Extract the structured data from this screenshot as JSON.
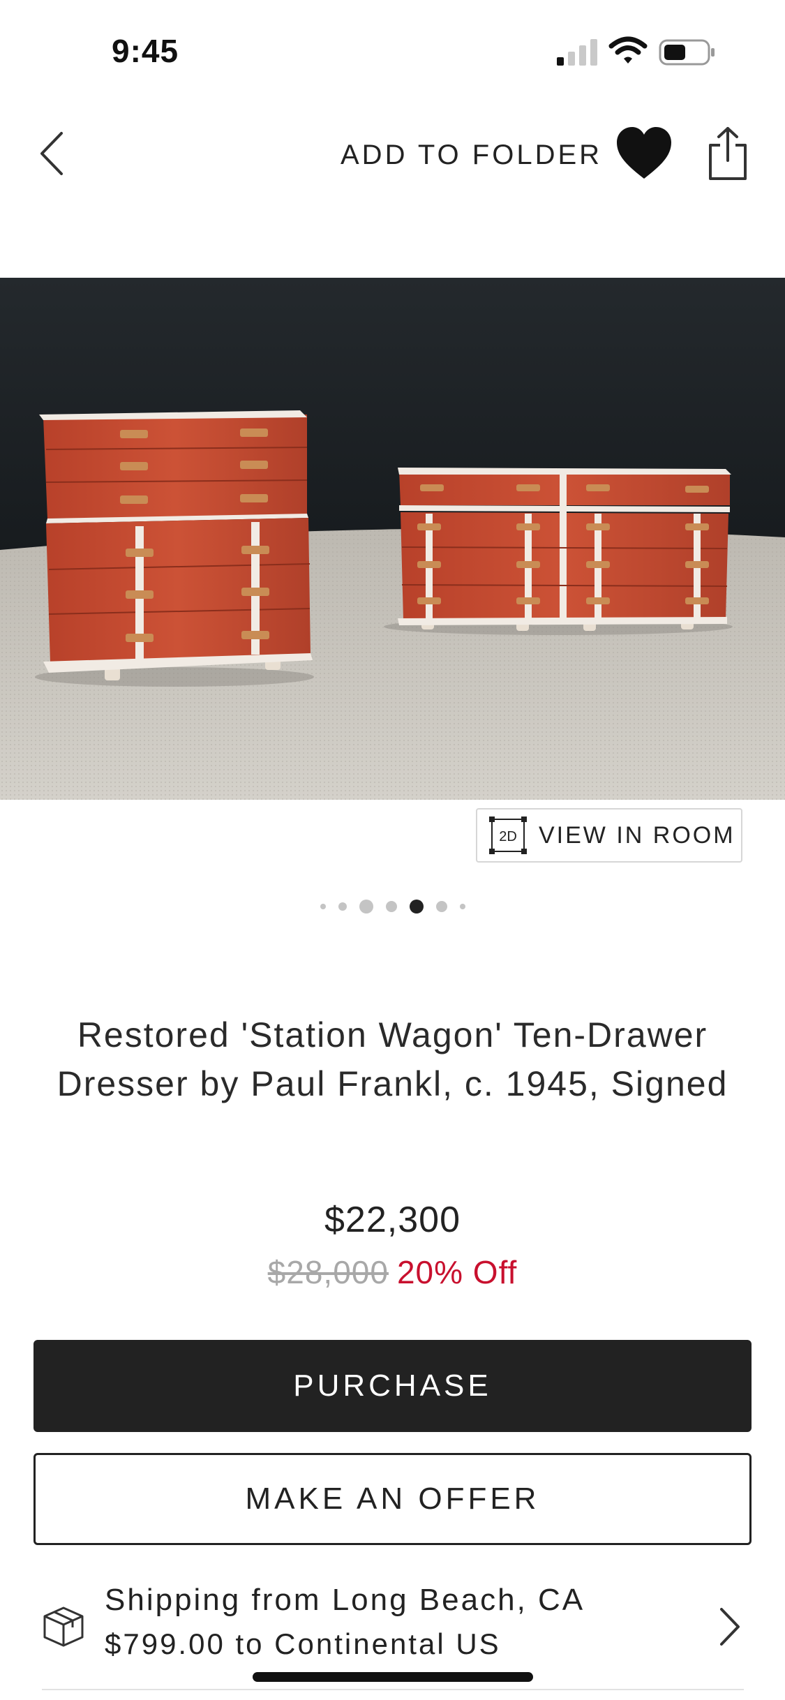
{
  "status_bar": {
    "time": "9:45"
  },
  "nav": {
    "add_to_folder_label": "ADD TO FOLDER",
    "back_icon": "chevron-left-icon",
    "heart_icon": "heart-filled-icon",
    "share_icon": "share-icon"
  },
  "product": {
    "image_alt": "Two red dressers with white trim and leather pulls on a grey carpet",
    "view_in_room_badge": "2D",
    "view_in_room_label": "VIEW IN ROOM",
    "carousel": {
      "total": 7,
      "active_index": 4
    },
    "title": "Restored 'Station Wagon' Ten-Drawer Dresser by Paul Frankl, c. 1945, Signed",
    "price": "$22,300",
    "original_price": "$28,000",
    "discount": "20% Off"
  },
  "actions": {
    "purchase_label": "PURCHASE",
    "offer_label": "MAKE AN OFFER"
  },
  "shipping": {
    "line1": "Shipping from Long Beach, CA",
    "line2": "$799.00 to Continental US",
    "icon": "package-box-icon"
  },
  "colors": {
    "primary_button": "#222222",
    "discount": "#c8102e",
    "strikethrough": "#a8a8a8"
  }
}
